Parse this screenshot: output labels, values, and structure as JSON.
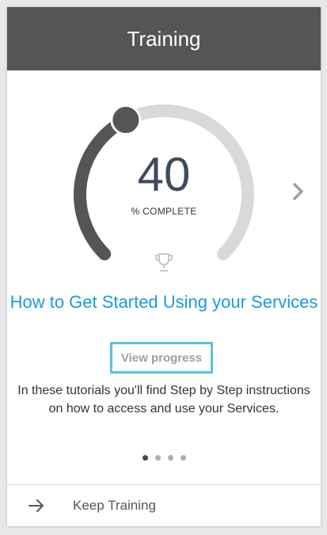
{
  "header": {
    "title": "Training"
  },
  "progress": {
    "value": "40",
    "percent": 40,
    "label": "% COMPLETE",
    "track_color": "#d9d9d9",
    "fill_color": "#555555"
  },
  "icons": {
    "trophy": "trophy-icon",
    "next": "chevron-right-icon",
    "footer_arrow": "arrow-right-icon"
  },
  "course": {
    "title": "How to Get Started Using your Services",
    "view_progress_label": "View progress",
    "description": "In these tutorials you'll find Step by Step instructions on how to access and use your Services."
  },
  "pagination": {
    "count": 4,
    "active": 1
  },
  "footer": {
    "label": "Keep Training"
  },
  "colors": {
    "header_bg": "#555555",
    "accent": "#1a9bd7",
    "focus_border": "#5bc0de",
    "text_dark": "#3d4b5c"
  }
}
